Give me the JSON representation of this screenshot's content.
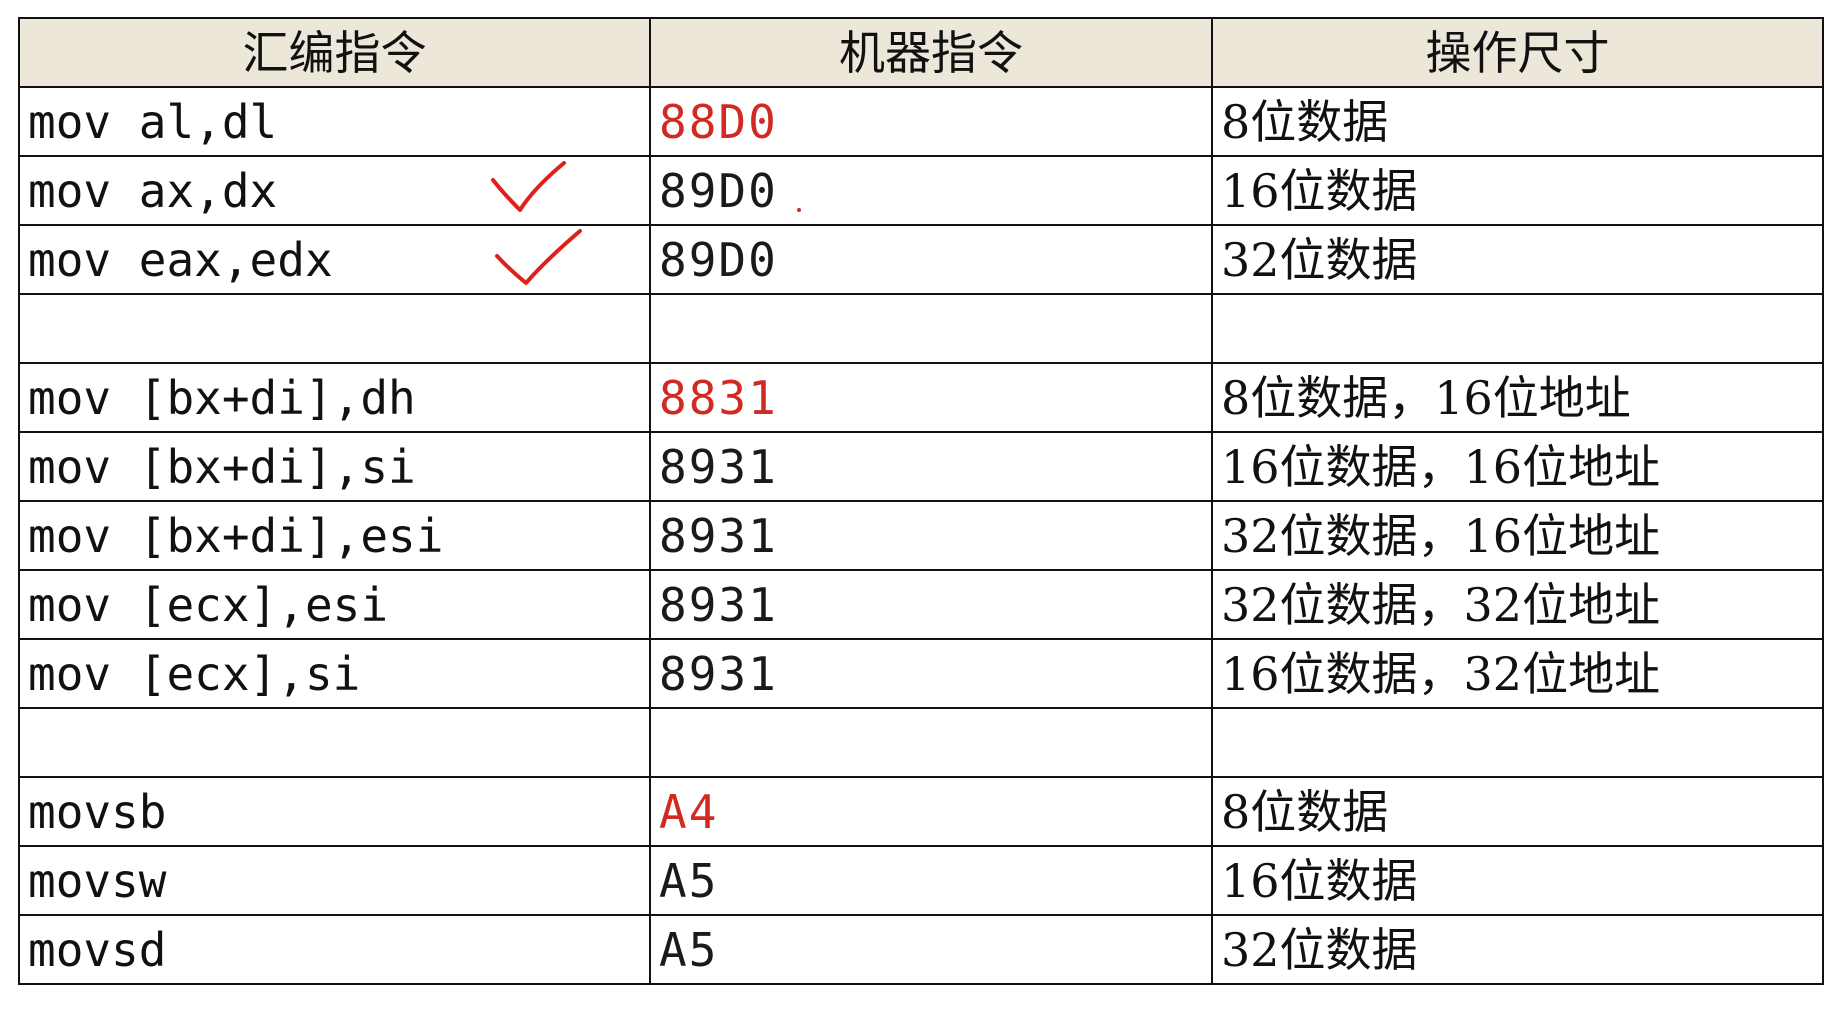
{
  "headers": {
    "asm": "汇编指令",
    "machine": "机器指令",
    "size": "操作尺寸"
  },
  "rows": [
    {
      "asm": "mov al,dl",
      "machine": "88D0",
      "size": "8位数据",
      "highlight": true
    },
    {
      "asm": "mov ax,dx",
      "machine": "89D0",
      "size": "16位数据",
      "highlight": false
    },
    {
      "asm": "mov eax,edx",
      "machine": "89D0",
      "size": "32位数据",
      "highlight": false
    },
    {
      "asm": "",
      "machine": "",
      "size": "",
      "highlight": false
    },
    {
      "asm": "mov [bx+di],dh",
      "machine": "8831",
      "size": "8位数据，16位地址",
      "highlight": true
    },
    {
      "asm": "mov [bx+di],si",
      "machine": "8931",
      "size": "16位数据，16位地址",
      "highlight": false
    },
    {
      "asm": "mov [bx+di],esi",
      "machine": "8931",
      "size": "32位数据，16位地址",
      "highlight": false
    },
    {
      "asm": "mov [ecx],esi",
      "machine": "8931",
      "size": "32位数据，32位地址",
      "highlight": false
    },
    {
      "asm": "mov [ecx],si",
      "machine": "8931",
      "size": "16位数据，32位地址",
      "highlight": false
    },
    {
      "asm": "",
      "machine": "",
      "size": "",
      "highlight": false
    },
    {
      "asm": "movsb",
      "machine": "A4",
      "size": "8位数据",
      "highlight": true
    },
    {
      "asm": "movsw",
      "machine": "A5",
      "size": "16位数据",
      "highlight": false
    },
    {
      "asm": "movsd",
      "machine": "A5",
      "size": "32位数据",
      "highlight": false
    }
  ],
  "colors": {
    "header_bg": "#ece7d9",
    "highlight": "#d02a22",
    "annotation": "#e0211b",
    "border": "#111111"
  },
  "annotations": [
    "checkmark-icon",
    "checkmark-icon"
  ]
}
